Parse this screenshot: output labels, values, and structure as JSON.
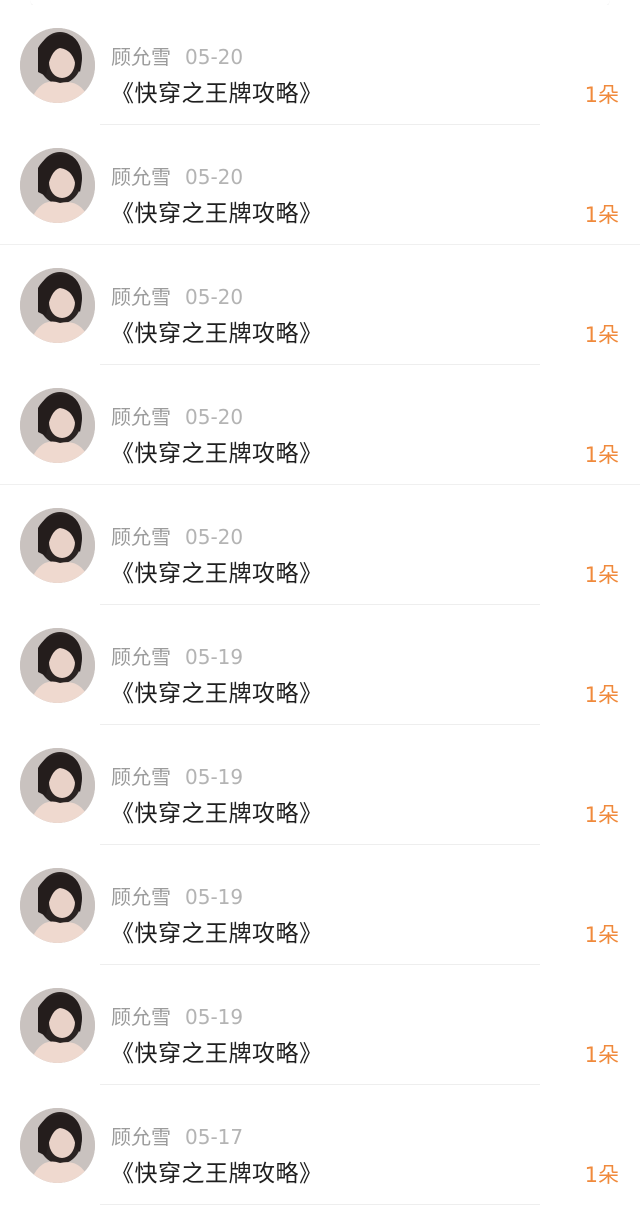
{
  "gift_records": [
    {
      "sender": "顾允雪",
      "date": "05-20",
      "book": "《快穿之王牌攻略》",
      "amount": "1朵",
      "avatar_icon": "user-avatar-photo"
    },
    {
      "sender": "顾允雪",
      "date": "05-20",
      "book": "《快穿之王牌攻略》",
      "amount": "1朵",
      "avatar_icon": "user-avatar-photo"
    },
    {
      "sender": "顾允雪",
      "date": "05-20",
      "book": "《快穿之王牌攻略》",
      "amount": "1朵",
      "avatar_icon": "user-avatar-photo"
    },
    {
      "sender": "顾允雪",
      "date": "05-20",
      "book": "《快穿之王牌攻略》",
      "amount": "1朵",
      "avatar_icon": "user-avatar-photo"
    },
    {
      "sender": "顾允雪",
      "date": "05-20",
      "book": "《快穿之王牌攻略》",
      "amount": "1朵",
      "avatar_icon": "user-avatar-photo"
    },
    {
      "sender": "顾允雪",
      "date": "05-19",
      "book": "《快穿之王牌攻略》",
      "amount": "1朵",
      "avatar_icon": "user-avatar-photo"
    },
    {
      "sender": "顾允雪",
      "date": "05-19",
      "book": "《快穿之王牌攻略》",
      "amount": "1朵",
      "avatar_icon": "user-avatar-photo"
    },
    {
      "sender": "顾允雪",
      "date": "05-19",
      "book": "《快穿之王牌攻略》",
      "amount": "1朵",
      "avatar_icon": "user-avatar-photo"
    },
    {
      "sender": "顾允雪",
      "date": "05-19",
      "book": "《快穿之王牌攻略》",
      "amount": "1朵",
      "avatar_icon": "user-avatar-photo"
    },
    {
      "sender": "顾允雪",
      "date": "05-17",
      "book": "《快穿之王牌攻略》",
      "amount": "1朵",
      "avatar_icon": "user-avatar-photo"
    }
  ],
  "colors": {
    "amount": "#f08a3c",
    "meta": "#9b9b9b",
    "title": "#1e1e1e"
  }
}
